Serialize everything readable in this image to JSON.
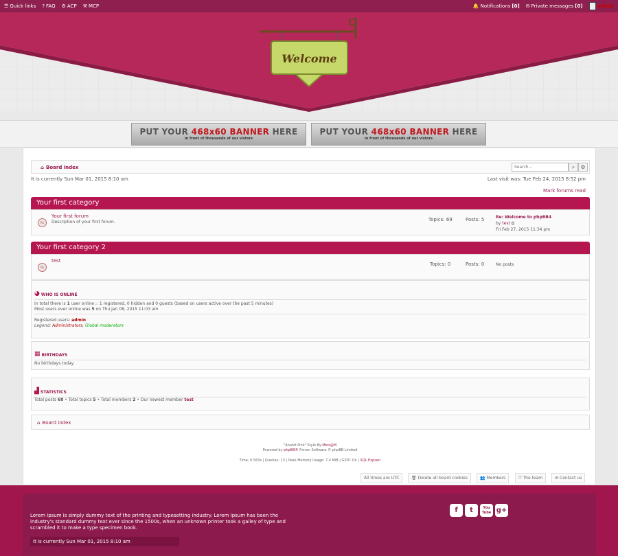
{
  "topbar": {
    "quick_links": "Quick links",
    "faq": "FAQ",
    "acp": "ACP",
    "mcp": "MCP",
    "notifications_label": "Notifications",
    "notifications_count": "[0]",
    "pm_label": "Private messages",
    "pm_count": "[0]",
    "username": "admin"
  },
  "header": {
    "sign_text": "Welcome"
  },
  "banners": [
    {
      "line1_pre": "PUT YOUR ",
      "line1_red": "468x60 BANNER",
      "line1_post": " HERE",
      "line2": "in front of thousands of our vistors"
    },
    {
      "line1_pre": "PUT YOUR ",
      "line1_red": "468x60 BANNER",
      "line1_post": " HERE",
      "line2": "in front of thousands of our vistors"
    }
  ],
  "nav": {
    "board_index": "Board index",
    "search_placeholder": "Search…"
  },
  "current_time": "It is currently Sun Mar 01, 2015 8:10 am",
  "last_visit": "Last visit was: Tue Feb 24, 2015 8:52 pm",
  "mark_read": "Mark forums read",
  "categories": [
    {
      "title": "Your first category",
      "forum": {
        "name": "Your first forum",
        "desc": "Description of your first forum.",
        "topics": "Topics: 69",
        "posts": "Posts: 5",
        "last_title": "Re: Welcome to phpBB4",
        "last_by": "by ",
        "last_user": "test",
        "last_date": "Fri Feb 27, 2015 11:34 pm"
      }
    },
    {
      "title": "Your first category 2",
      "forum": {
        "name": "test",
        "desc": "",
        "topics": "Topics: 0",
        "posts": "Posts: 0",
        "last_title": "No posts"
      }
    }
  ],
  "who_online": {
    "title": "Who is online",
    "line1_a": "In total there is ",
    "line1_b": "1",
    "line1_c": " user online :: 1 registered, 0 hidden and 0 guests (based on users active over the past 5 minutes)",
    "line2_a": "Most users ever online was ",
    "line2_b": "5",
    "line2_c": " on Thu Jan 08, 2015 11:03 am",
    "registered_label": "Registered users: ",
    "registered_user": "admin",
    "legend_label": "Legend: ",
    "legend_admins": "Administrators",
    "legend_sep": ", ",
    "legend_mods": "Global moderators"
  },
  "birthdays": {
    "title": "Birthdays",
    "text": "No birthdays today"
  },
  "statistics": {
    "title": "Statistics",
    "posts_label": "Total posts ",
    "posts": "68",
    "topics_label": " • Total topics ",
    "topics": "5",
    "members_label": " • Total members ",
    "members": "2",
    "newest_label": " • Our newest member ",
    "newest": "test"
  },
  "bottom_nav": {
    "board_index": "Board index"
  },
  "credits": {
    "style_a": "\"Anahit-Pink\" Style By:",
    "style_b": "Meis@M",
    "powered_a": "Powered by ",
    "powered_b": "phpBB®",
    "powered_c": " Forum Software © phpBB Limited",
    "debug_a": "Time: 0.563s | Queries: 13 | Peak Memory Usage: 7.4 MiB | GZIP: On | ",
    "debug_b": "SQL Explain"
  },
  "footer_buttons": {
    "timezone": "All times are UTC",
    "delete_cookies": "Delete all board cookies",
    "members": "Members",
    "team": "The team",
    "contact": "Contact us"
  },
  "bottom": {
    "lorem": "Lorem Ipsum is simply dummy text of the printing and typesetting industry. Lorem Ipsum has been the industry's standard dummy text ever since the 1500s, when an unknown printer took a galley of type and scrambled it to make a type specimen book.",
    "time": "It is currently Sun Mar 01, 2015 8:10 am",
    "social": [
      "f",
      "t",
      "You Tube",
      "g+"
    ]
  }
}
